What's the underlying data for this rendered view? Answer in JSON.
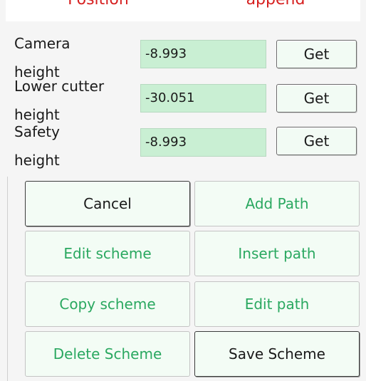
{
  "tabs": [
    {
      "label": "Position"
    },
    {
      "label": "append"
    }
  ],
  "params": {
    "camera_height": {
      "label_line1": "Camera",
      "label_line2": "height",
      "value": "-8.993",
      "button": "Get"
    },
    "lower_cutter_height": {
      "label_line1": "Lower cutter",
      "label_line2": "height",
      "value": "-30.051",
      "button": "Get"
    },
    "safety_height": {
      "label_line1": "Safety",
      "label_line2": "height",
      "value": "-8.993",
      "button": "Get"
    }
  },
  "actions": {
    "cancel": "Cancel",
    "add_path": "Add Path",
    "edit_scheme": "Edit scheme",
    "insert_path": "Insert path",
    "copy_scheme": "Copy scheme",
    "edit_path": "Edit path",
    "delete_scheme": "Delete Scheme",
    "save_scheme": "Save Scheme"
  },
  "colors": {
    "tab_text": "#d62020",
    "value_bg": "#c9efd3",
    "action_green_text": "#2aa860",
    "button_bg": "#f3fcf5"
  }
}
